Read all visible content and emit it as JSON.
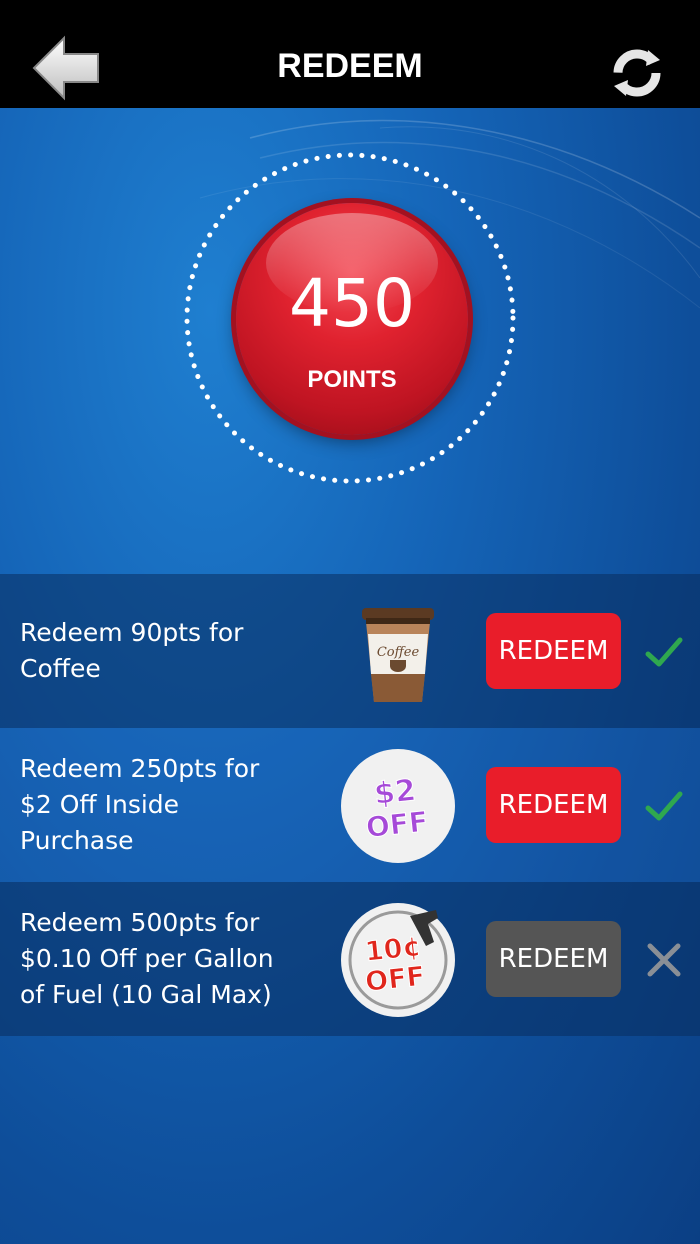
{
  "header": {
    "title": "REDEEM",
    "back_icon": "arrow-left-icon",
    "refresh_icon": "refresh-icon"
  },
  "points": {
    "value": "450",
    "label": "POINTS"
  },
  "colors": {
    "accent_red": "#e91d2a",
    "disabled_gray": "#555555",
    "check_green": "#2fa84f",
    "background_blue": "#1565b8"
  },
  "offers": [
    {
      "text": "Redeem 90pts for\nCoffee",
      "image_icon": "coffee-cup-icon",
      "button_label": "REDEEM",
      "available": true,
      "status_icon": "checkmark-icon"
    },
    {
      "text": "Redeem 250pts for\n$2 Off Inside\nPurchase",
      "image_icon": "two-dollars-off-badge-icon",
      "image_text": [
        "$2",
        "OFF"
      ],
      "button_label": "REDEEM",
      "available": true,
      "status_icon": "checkmark-icon"
    },
    {
      "text": "Redeem 500pts for\n$0.10 Off per Gallon\nof Fuel (10 Gal Max)",
      "image_icon": "ten-cents-off-fuel-badge-icon",
      "image_text": [
        "10¢",
        "OFF"
      ],
      "button_label": "REDEEM",
      "available": false,
      "status_icon": "x-mark-icon"
    }
  ]
}
